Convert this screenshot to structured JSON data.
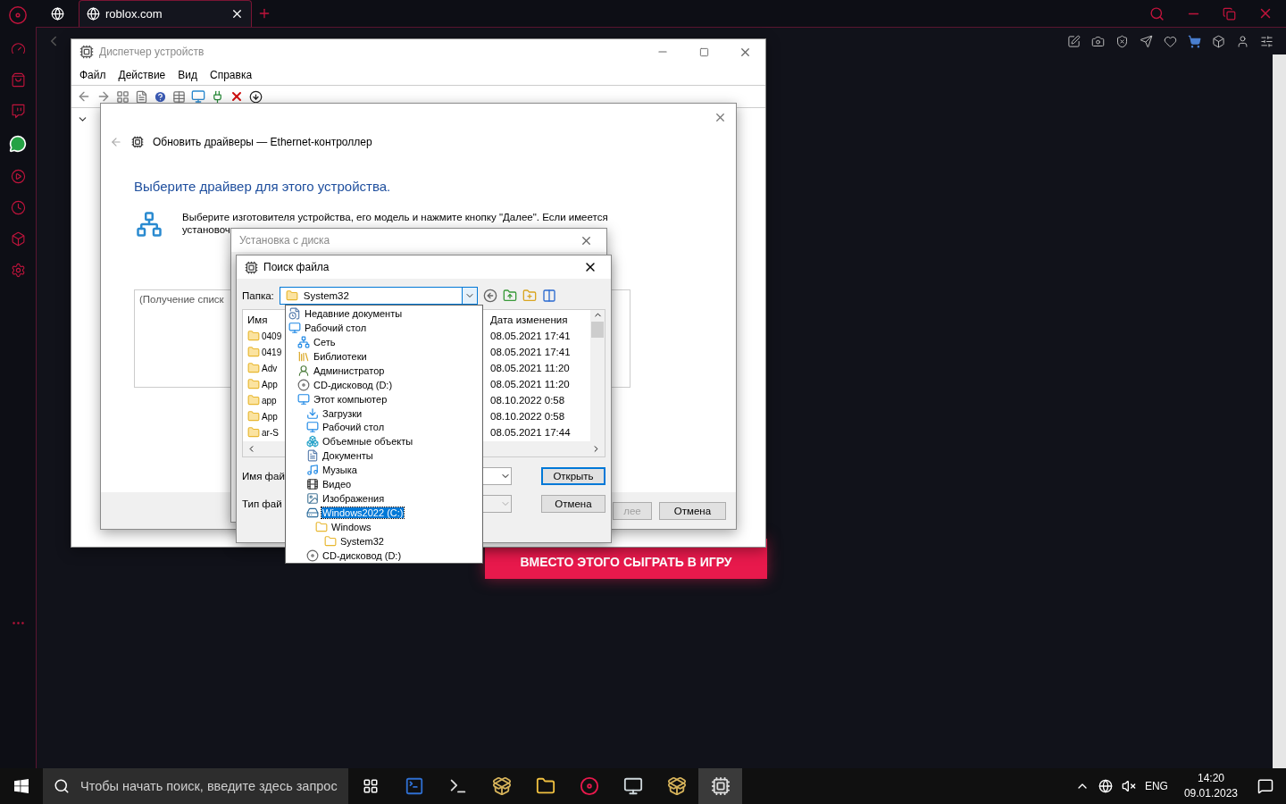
{
  "browser": {
    "tabs": [
      {
        "kind": "pinned",
        "selected": false
      },
      {
        "kind": "page",
        "label": "roblox.com",
        "selected": true
      }
    ]
  },
  "device_manager": {
    "title": "Диспетчер устройств",
    "menu": [
      "Файл",
      "Действие",
      "Вид",
      "Справка"
    ]
  },
  "update_driver": {
    "title": "Обновить драйверы — Ethernet-контроллер",
    "heading": "Выберите драйвер для этого устройства.",
    "description_lines": [
      "Выберите изготовителя устройства, его модель и нажмите кнопку \"Далее\". Если имеется",
      "установоч"
    ],
    "list_text": "(Получение списк",
    "buttons": [
      {
        "label": "лее",
        "disabled": true
      },
      {
        "label": "Отмена",
        "disabled": false
      }
    ]
  },
  "install_from_disk": {
    "title": "Установка с диска"
  },
  "file_dialog": {
    "title": "Поиск файла",
    "folder_label": "Папка:",
    "folder": "System32",
    "columns": [
      "Имя",
      "Дата изменения"
    ],
    "rows": [
      {
        "name": "0409",
        "date": "08.05.2021 17:41"
      },
      {
        "name": "0419",
        "date": "08.05.2021 17:41"
      },
      {
        "name": "Adv",
        "date": "08.05.2021 11:20"
      },
      {
        "name": "App",
        "date": "08.05.2021 11:20"
      },
      {
        "name": "app",
        "date": "08.10.2022 0:58"
      },
      {
        "name": "App",
        "date": "08.10.2022 0:58"
      },
      {
        "name": "ar-S",
        "date": "08.05.2021 17:44"
      }
    ],
    "file_name_label": "Имя фай",
    "file_type_label": "Тип фай",
    "buttons": [
      {
        "label": "Открыть",
        "default": true
      },
      {
        "label": "Отмена",
        "default": false
      }
    ]
  },
  "folder_dropdown": {
    "items": [
      {
        "kind": "recent",
        "label": "Недавние документы",
        "selected": false
      },
      {
        "kind": "desktop",
        "label": "Рабочий стол",
        "selected": false,
        "children": [
          {
            "kind": "network",
            "label": "Сеть",
            "selected": false
          },
          {
            "kind": "library",
            "label": "Библиотеки",
            "selected": false
          },
          {
            "kind": "user",
            "label": "Администратор",
            "selected": false
          },
          {
            "kind": "cd",
            "label": "CD-дисковод (D:)",
            "selected": false
          },
          {
            "kind": "computer",
            "label": "Этот компьютер",
            "selected": false,
            "children": [
              {
                "kind": "download",
                "label": "Загрузки",
                "selected": false
              },
              {
                "kind": "desktop",
                "label": "Рабочий стол",
                "selected": false
              },
              {
                "kind": "objects",
                "label": "Объемные объекты",
                "selected": false
              },
              {
                "kind": "documents",
                "label": "Документы",
                "selected": false
              },
              {
                "kind": "music",
                "label": "Музыка",
                "selected": false
              },
              {
                "kind": "video",
                "label": "Видео",
                "selected": false
              },
              {
                "kind": "images",
                "label": "Изображения",
                "selected": false
              },
              {
                "kind": "drive",
                "label": "Windows2022 (C:)",
                "selected": true,
                "children": [
                  {
                    "kind": "folder",
                    "label": "Windows",
                    "selected": false,
                    "children": [
                      {
                        "kind": "folder",
                        "label": "System32",
                        "selected": false
                      }
                    ]
                  }
                ]
              },
              {
                "kind": "cd",
                "label": "CD-дисковод (D:)",
                "selected": false
              }
            ]
          }
        ]
      }
    ]
  },
  "promo_button": "ВМЕСТО ЭТОГО СЫГРАТЬ В ИГРУ",
  "taskbar": {
    "search_placeholder": "Чтобы начать поиск, введите здесь запрос",
    "apps": [
      {
        "kind": "powershell",
        "selected": false
      },
      {
        "kind": "terminal",
        "selected": false
      },
      {
        "kind": "installer",
        "selected": false
      },
      {
        "kind": "explorer",
        "selected": false
      },
      {
        "kind": "opera",
        "selected": false
      },
      {
        "kind": "monitor",
        "selected": false
      },
      {
        "kind": "installer",
        "selected": false
      },
      {
        "kind": "device",
        "selected": true
      }
    ],
    "language": "ENG",
    "time": "14:20",
    "date": "09.01.2023"
  }
}
